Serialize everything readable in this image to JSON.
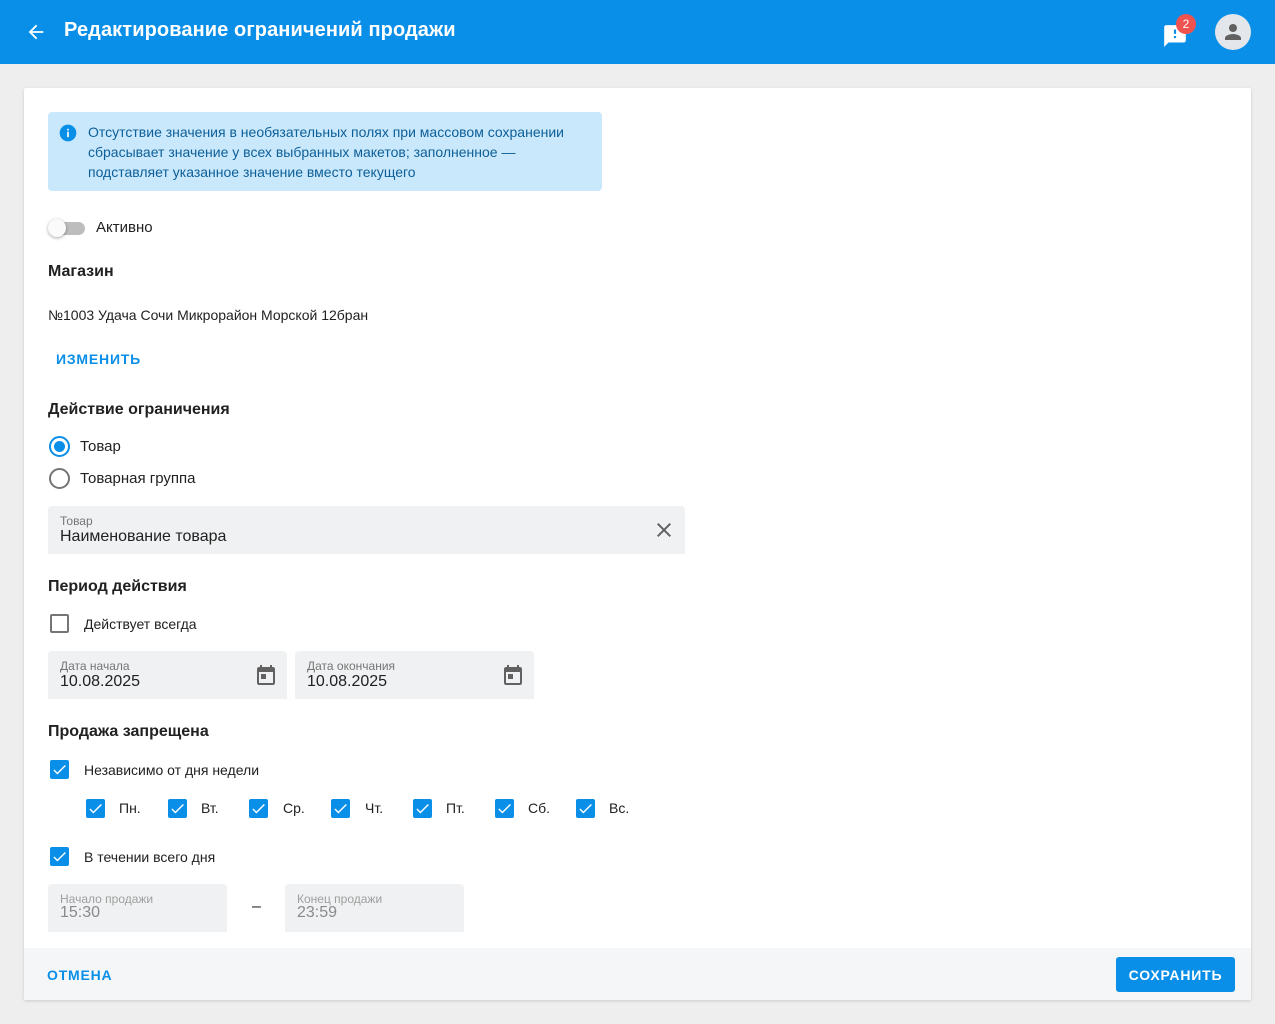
{
  "appbar": {
    "title": "Редактирование ограничений продажи",
    "notification_count": "2",
    "color": "#0a8fe8"
  },
  "info": {
    "text": "Отсутствие значения в необязательных полях при массовом сохранении сбрасывает значение у всех выбранных макетов; заполненное — подставляет указанное значение вместо текущего"
  },
  "active_toggle": {
    "label": "Активно",
    "checked": false
  },
  "store": {
    "heading": "Магазин",
    "value": "№1003 Удача Сочи Микрорайон Морской 12бран",
    "change_label": "ИЗМЕНИТЬ"
  },
  "restriction": {
    "heading": "Действие ограничения",
    "options": [
      {
        "label": "Товар",
        "selected": true
      },
      {
        "label": "Товарная группа",
        "selected": false
      }
    ],
    "product_field": {
      "label": "Товар",
      "value": "Наименование товара"
    }
  },
  "period": {
    "heading": "Период действия",
    "always_label": "Действует всегда",
    "always_checked": false,
    "start": {
      "label": "Дата начала",
      "value": "10.08.2025"
    },
    "end": {
      "label": "Дата окончания",
      "value": "10.08.2025"
    }
  },
  "sale_banned": {
    "heading": "Продажа запрещена",
    "any_day_label": "Независимо от дня недели",
    "days": [
      "Пн.",
      "Вт.",
      "Ср.",
      "Чт.",
      "Пт.",
      "Сб.",
      "Вс."
    ],
    "all_day_label": "В течении всего дня",
    "start": {
      "label": "Начало продажи",
      "value": "15:30"
    },
    "separator": "–",
    "end": {
      "label": "Конец продажи",
      "value": "23:59"
    }
  },
  "footer": {
    "cancel_label": "ОТМЕНА",
    "save_label": "СОХРАНИТЬ"
  }
}
